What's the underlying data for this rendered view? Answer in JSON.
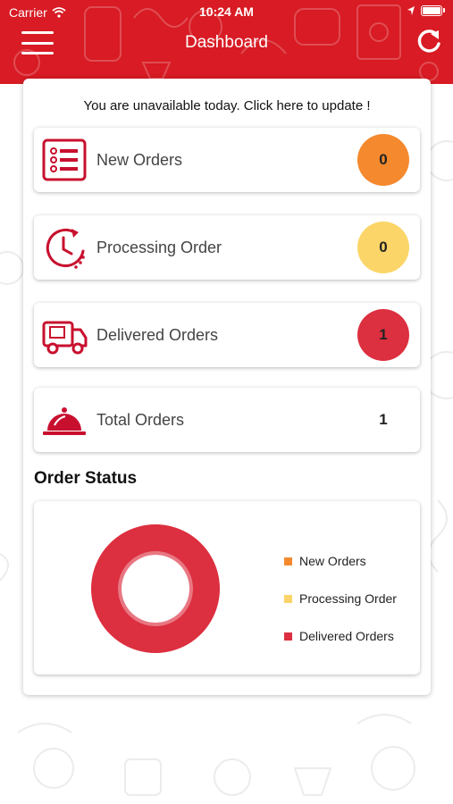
{
  "status_bar": {
    "carrier": "Carrier",
    "time": "10:24 AM"
  },
  "header": {
    "title": "Dashboard",
    "menu_icon": "hamburger-menu-icon",
    "refresh_icon": "refresh-icon"
  },
  "notice": "You are unavailable today. Click here to update !",
  "cards": [
    {
      "label": "New Orders",
      "count": "0",
      "icon": "order-list-icon",
      "badge_color": "#f4892e"
    },
    {
      "label": "Processing Order",
      "count": "0",
      "icon": "clock-icon",
      "badge_color": "#fbd567"
    },
    {
      "label": "Delivered Orders",
      "count": "1",
      "icon": "delivery-truck-icon",
      "badge_color": "#dc2f3f"
    },
    {
      "label": "Total Orders",
      "count": "1",
      "icon": "food-cloche-icon"
    }
  ],
  "order_status": {
    "title": "Order Status",
    "chart_data": {
      "type": "pie",
      "categories": [
        "New Orders",
        "Processing Order",
        "Delivered Orders"
      ],
      "values": [
        0,
        0,
        1
      ],
      "colors": [
        "#f4892e",
        "#fbd567",
        "#dc2f3f"
      ],
      "legend_position": "right"
    }
  },
  "colors": {
    "brand_red": "#d81b24",
    "icon_red": "#c8102e"
  }
}
